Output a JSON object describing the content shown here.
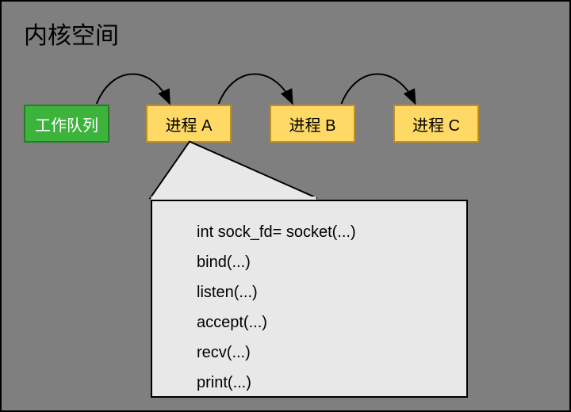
{
  "title": "内核空间",
  "queue_label": "工作队列",
  "processes": {
    "a": "进程 A",
    "b": "进程 B",
    "c": "进程 C"
  },
  "code_lines": [
    "int sock_fd= socket(...)",
    "bind(...)",
    "listen(...)",
    "accept(...)",
    "recv(...)",
    "print(...)"
  ]
}
